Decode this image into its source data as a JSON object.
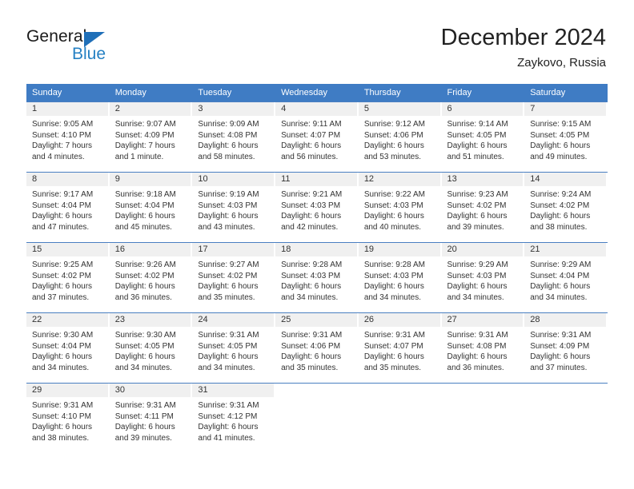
{
  "brand": {
    "name_part1": "General",
    "name_part2": "Blue",
    "triangle_icon": "triangle-icon",
    "accent_color": "#2580c3",
    "triangle_color": "#1f6fb8"
  },
  "header": {
    "title": "December 2024",
    "subtitle": "Zaykovo, Russia"
  },
  "theme": {
    "header_row_bg": "#3f7cc4",
    "header_row_text": "#ffffff",
    "daynum_band_bg": "#f0f0f0",
    "row_divider": "#4a7fc1"
  },
  "calendar": {
    "weekday_headers": [
      "Sunday",
      "Monday",
      "Tuesday",
      "Wednesday",
      "Thursday",
      "Friday",
      "Saturday"
    ],
    "weeks": [
      [
        {
          "day": "1",
          "sunrise": "Sunrise: 9:05 AM",
          "sunset": "Sunset: 4:10 PM",
          "daylight_line1": "Daylight: 7 hours",
          "daylight_line2": "and 4 minutes."
        },
        {
          "day": "2",
          "sunrise": "Sunrise: 9:07 AM",
          "sunset": "Sunset: 4:09 PM",
          "daylight_line1": "Daylight: 7 hours",
          "daylight_line2": "and 1 minute."
        },
        {
          "day": "3",
          "sunrise": "Sunrise: 9:09 AM",
          "sunset": "Sunset: 4:08 PM",
          "daylight_line1": "Daylight: 6 hours",
          "daylight_line2": "and 58 minutes."
        },
        {
          "day": "4",
          "sunrise": "Sunrise: 9:11 AM",
          "sunset": "Sunset: 4:07 PM",
          "daylight_line1": "Daylight: 6 hours",
          "daylight_line2": "and 56 minutes."
        },
        {
          "day": "5",
          "sunrise": "Sunrise: 9:12 AM",
          "sunset": "Sunset: 4:06 PM",
          "daylight_line1": "Daylight: 6 hours",
          "daylight_line2": "and 53 minutes."
        },
        {
          "day": "6",
          "sunrise": "Sunrise: 9:14 AM",
          "sunset": "Sunset: 4:05 PM",
          "daylight_line1": "Daylight: 6 hours",
          "daylight_line2": "and 51 minutes."
        },
        {
          "day": "7",
          "sunrise": "Sunrise: 9:15 AM",
          "sunset": "Sunset: 4:05 PM",
          "daylight_line1": "Daylight: 6 hours",
          "daylight_line2": "and 49 minutes."
        }
      ],
      [
        {
          "day": "8",
          "sunrise": "Sunrise: 9:17 AM",
          "sunset": "Sunset: 4:04 PM",
          "daylight_line1": "Daylight: 6 hours",
          "daylight_line2": "and 47 minutes."
        },
        {
          "day": "9",
          "sunrise": "Sunrise: 9:18 AM",
          "sunset": "Sunset: 4:04 PM",
          "daylight_line1": "Daylight: 6 hours",
          "daylight_line2": "and 45 minutes."
        },
        {
          "day": "10",
          "sunrise": "Sunrise: 9:19 AM",
          "sunset": "Sunset: 4:03 PM",
          "daylight_line1": "Daylight: 6 hours",
          "daylight_line2": "and 43 minutes."
        },
        {
          "day": "11",
          "sunrise": "Sunrise: 9:21 AM",
          "sunset": "Sunset: 4:03 PM",
          "daylight_line1": "Daylight: 6 hours",
          "daylight_line2": "and 42 minutes."
        },
        {
          "day": "12",
          "sunrise": "Sunrise: 9:22 AM",
          "sunset": "Sunset: 4:03 PM",
          "daylight_line1": "Daylight: 6 hours",
          "daylight_line2": "and 40 minutes."
        },
        {
          "day": "13",
          "sunrise": "Sunrise: 9:23 AM",
          "sunset": "Sunset: 4:02 PM",
          "daylight_line1": "Daylight: 6 hours",
          "daylight_line2": "and 39 minutes."
        },
        {
          "day": "14",
          "sunrise": "Sunrise: 9:24 AM",
          "sunset": "Sunset: 4:02 PM",
          "daylight_line1": "Daylight: 6 hours",
          "daylight_line2": "and 38 minutes."
        }
      ],
      [
        {
          "day": "15",
          "sunrise": "Sunrise: 9:25 AM",
          "sunset": "Sunset: 4:02 PM",
          "daylight_line1": "Daylight: 6 hours",
          "daylight_line2": "and 37 minutes."
        },
        {
          "day": "16",
          "sunrise": "Sunrise: 9:26 AM",
          "sunset": "Sunset: 4:02 PM",
          "daylight_line1": "Daylight: 6 hours",
          "daylight_line2": "and 36 minutes."
        },
        {
          "day": "17",
          "sunrise": "Sunrise: 9:27 AM",
          "sunset": "Sunset: 4:02 PM",
          "daylight_line1": "Daylight: 6 hours",
          "daylight_line2": "and 35 minutes."
        },
        {
          "day": "18",
          "sunrise": "Sunrise: 9:28 AM",
          "sunset": "Sunset: 4:03 PM",
          "daylight_line1": "Daylight: 6 hours",
          "daylight_line2": "and 34 minutes."
        },
        {
          "day": "19",
          "sunrise": "Sunrise: 9:28 AM",
          "sunset": "Sunset: 4:03 PM",
          "daylight_line1": "Daylight: 6 hours",
          "daylight_line2": "and 34 minutes."
        },
        {
          "day": "20",
          "sunrise": "Sunrise: 9:29 AM",
          "sunset": "Sunset: 4:03 PM",
          "daylight_line1": "Daylight: 6 hours",
          "daylight_line2": "and 34 minutes."
        },
        {
          "day": "21",
          "sunrise": "Sunrise: 9:29 AM",
          "sunset": "Sunset: 4:04 PM",
          "daylight_line1": "Daylight: 6 hours",
          "daylight_line2": "and 34 minutes."
        }
      ],
      [
        {
          "day": "22",
          "sunrise": "Sunrise: 9:30 AM",
          "sunset": "Sunset: 4:04 PM",
          "daylight_line1": "Daylight: 6 hours",
          "daylight_line2": "and 34 minutes."
        },
        {
          "day": "23",
          "sunrise": "Sunrise: 9:30 AM",
          "sunset": "Sunset: 4:05 PM",
          "daylight_line1": "Daylight: 6 hours",
          "daylight_line2": "and 34 minutes."
        },
        {
          "day": "24",
          "sunrise": "Sunrise: 9:31 AM",
          "sunset": "Sunset: 4:05 PM",
          "daylight_line1": "Daylight: 6 hours",
          "daylight_line2": "and 34 minutes."
        },
        {
          "day": "25",
          "sunrise": "Sunrise: 9:31 AM",
          "sunset": "Sunset: 4:06 PM",
          "daylight_line1": "Daylight: 6 hours",
          "daylight_line2": "and 35 minutes."
        },
        {
          "day": "26",
          "sunrise": "Sunrise: 9:31 AM",
          "sunset": "Sunset: 4:07 PM",
          "daylight_line1": "Daylight: 6 hours",
          "daylight_line2": "and 35 minutes."
        },
        {
          "day": "27",
          "sunrise": "Sunrise: 9:31 AM",
          "sunset": "Sunset: 4:08 PM",
          "daylight_line1": "Daylight: 6 hours",
          "daylight_line2": "and 36 minutes."
        },
        {
          "day": "28",
          "sunrise": "Sunrise: 9:31 AM",
          "sunset": "Sunset: 4:09 PM",
          "daylight_line1": "Daylight: 6 hours",
          "daylight_line2": "and 37 minutes."
        }
      ],
      [
        {
          "day": "29",
          "sunrise": "Sunrise: 9:31 AM",
          "sunset": "Sunset: 4:10 PM",
          "daylight_line1": "Daylight: 6 hours",
          "daylight_line2": "and 38 minutes."
        },
        {
          "day": "30",
          "sunrise": "Sunrise: 9:31 AM",
          "sunset": "Sunset: 4:11 PM",
          "daylight_line1": "Daylight: 6 hours",
          "daylight_line2": "and 39 minutes."
        },
        {
          "day": "31",
          "sunrise": "Sunrise: 9:31 AM",
          "sunset": "Sunset: 4:12 PM",
          "daylight_line1": "Daylight: 6 hours",
          "daylight_line2": "and 41 minutes."
        },
        {
          "day": "",
          "sunrise": "",
          "sunset": "",
          "daylight_line1": "",
          "daylight_line2": ""
        },
        {
          "day": "",
          "sunrise": "",
          "sunset": "",
          "daylight_line1": "",
          "daylight_line2": ""
        },
        {
          "day": "",
          "sunrise": "",
          "sunset": "",
          "daylight_line1": "",
          "daylight_line2": ""
        },
        {
          "day": "",
          "sunrise": "",
          "sunset": "",
          "daylight_line1": "",
          "daylight_line2": ""
        }
      ]
    ]
  }
}
